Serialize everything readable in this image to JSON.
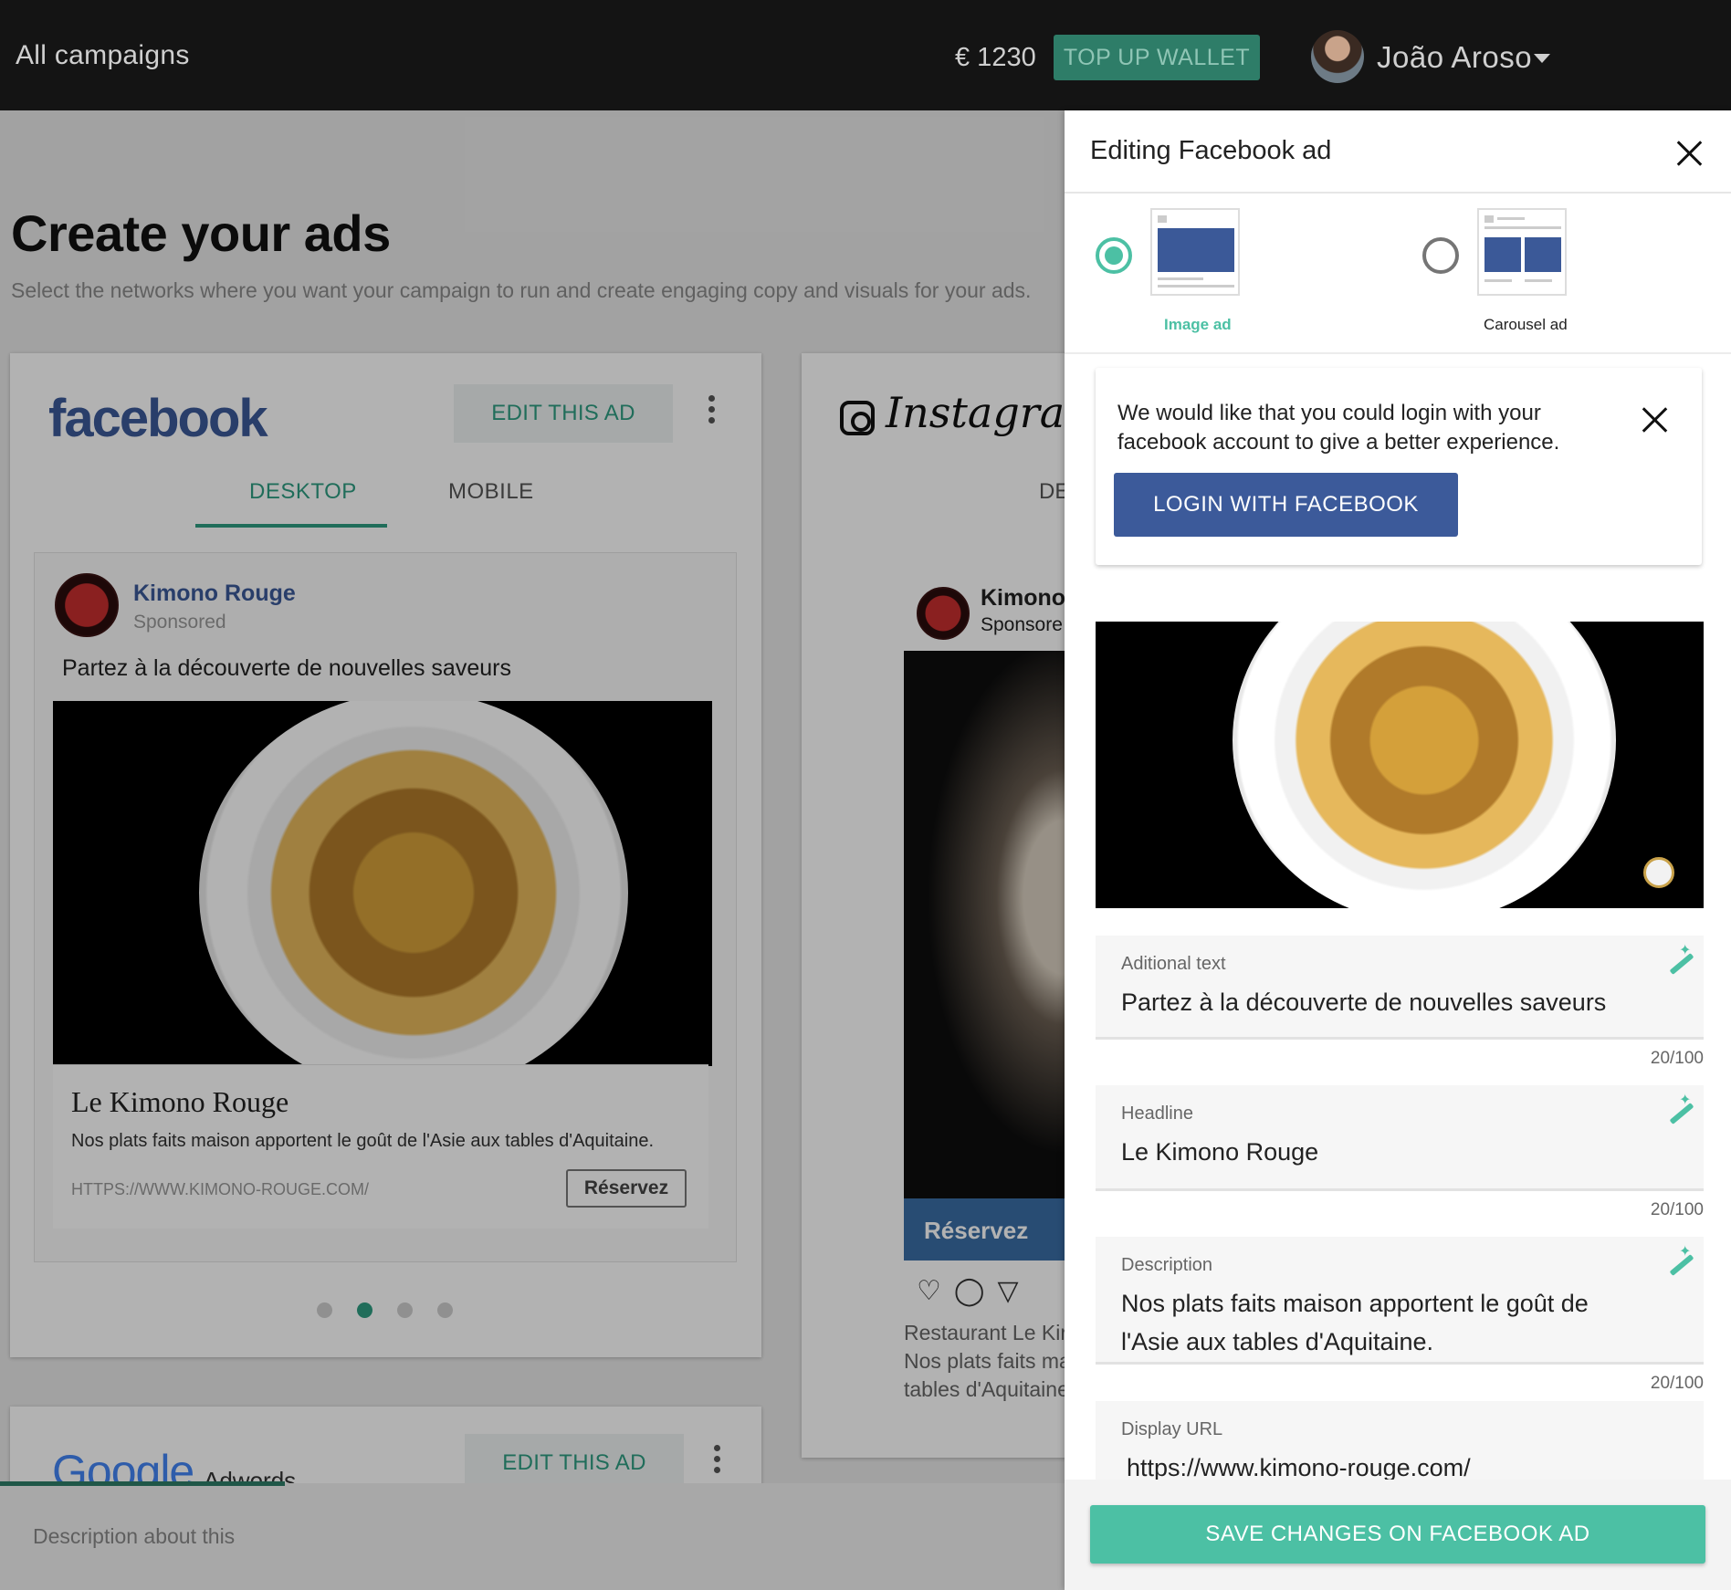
{
  "topbar": {
    "all_campaigns": "All campaigns",
    "wallet": "€ 1230",
    "top_up": "TOP UP WALLET",
    "user_name": "João Aroso"
  },
  "page": {
    "title": "Create your ads",
    "subtitle": "Select the networks where you want your campaign to run and create engaging copy and visuals for your ads."
  },
  "facebook_card": {
    "logo": "facebook",
    "edit_label": "EDIT THIS AD",
    "tabs": [
      "DESKTOP",
      "MOBILE"
    ],
    "active_tab": "DESKTOP",
    "post": {
      "page_name": "Kimono Rouge",
      "sponsored": "Sponsored",
      "text": "Partez à la découverte de nouvelles saveurs",
      "link_title": "Le Kimono Rouge",
      "link_desc": "Nos plats faits maison apportent le goût de l'Asie aux tables d'Aquitaine.",
      "link_url": "HTTPS://WWW.KIMONO-ROUGE.COM/",
      "cta": "Réservez"
    },
    "carousel_dots": 4,
    "active_dot": 2
  },
  "instagram_card": {
    "logo": "Instagram",
    "tab_partial": "DE",
    "page_name": "Kimono",
    "sponsored": "Sponsore",
    "cta": "Réservez",
    "caption_lines": [
      "Restaurant Le Kir",
      "Nos plats faits ma",
      "tables d'Aquitaine"
    ]
  },
  "google_card": {
    "logo": "Google",
    "logo_sub": "Adwords",
    "edit_label": "EDIT THIS AD"
  },
  "bottom_strip": {
    "description": "Description about this"
  },
  "panel": {
    "title": "Editing Facebook ad",
    "formats": [
      {
        "label": "Image ad",
        "selected": true
      },
      {
        "label": "Carousel ad",
        "selected": false
      }
    ],
    "login_notice": "We would like that you could login with your facebook account to give a better experience.",
    "login_button": "LOGIN WITH FACEBOOK",
    "fields": {
      "additional_text": {
        "label": "Aditional text",
        "value": "Partez à la découverte de nouvelles saveurs",
        "counter": "20/100"
      },
      "headline": {
        "label": "Headline",
        "value": "Le Kimono Rouge",
        "counter": "20/100"
      },
      "description": {
        "label": "Description",
        "value": "Nos plats faits maison apportent le goût de l'Asie aux tables d'Aquitaine.",
        "counter": "20/100"
      },
      "display_url": {
        "label": "Display URL",
        "value": "https://www.kimono-rouge.com/"
      }
    },
    "save_button": "SAVE CHANGES ON FACEBOOK AD"
  },
  "colors": {
    "accent": "#4cc0a4",
    "accent_dark": "#2e7d68",
    "facebook_blue": "#3b5998",
    "topbar": "#141414"
  }
}
